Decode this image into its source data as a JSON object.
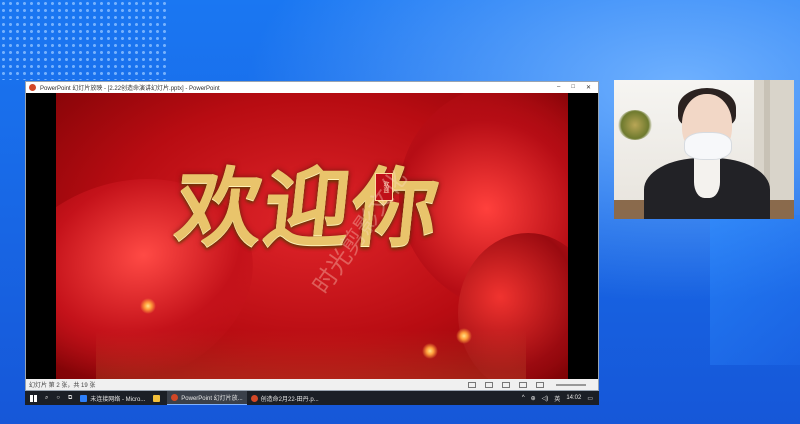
{
  "ppt_window": {
    "title": "PowerPoint 幻灯片放映 - [2.22创造命演讲幻灯片.pptx] - PowerPoint",
    "controls": [
      "–",
      "□",
      "✕"
    ],
    "status_slide_info": "幻灯片 第 2 张，共 19 张"
  },
  "slide": {
    "headline": "欢迎你",
    "seal_text": "欢迎",
    "watermark": "时光剪影文化"
  },
  "taskbar": {
    "search_icon": "search-icon",
    "items": [
      {
        "label": "未连接网络 - Micro...",
        "icon_color": "#2d7ff9"
      },
      {
        "label": "",
        "icon_color": "#f3c03a"
      },
      {
        "label": "PowerPoint 幻灯片放...",
        "icon_color": "#d24726"
      },
      {
        "label": "创造命2月22-田丹.p...",
        "icon_color": "#d24726"
      }
    ],
    "tray_lang": "英",
    "clock": "14:02"
  },
  "colors": {
    "background_blue": "#1f6fe0",
    "slide_red": "#c4121a",
    "gold": "#e9c46b"
  }
}
